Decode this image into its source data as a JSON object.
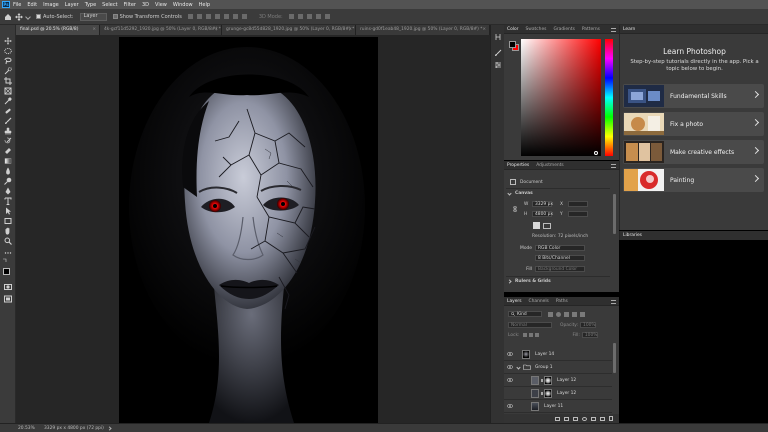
{
  "menubar": {
    "items": [
      "File",
      "Edit",
      "Image",
      "Layer",
      "Type",
      "Select",
      "Filter",
      "3D",
      "View",
      "Window",
      "Help"
    ]
  },
  "options": {
    "auto_select_label": "Auto-Select:",
    "auto_select_checked": true,
    "target_value": "Layer",
    "transform_controls_label": "Show Transform Controls",
    "transform_controls_checked": false,
    "mode_3d_label": "3D Mode:"
  },
  "tabs": [
    {
      "label": "final.psd @ 20.5% (RGB/8)",
      "active": true
    },
    {
      "label": "4k-gcf11d5292_1920.jpg @ 50% (Layer 0, RGB/8#) *",
      "active": false
    },
    {
      "label": "grunge-gc8d55d828_1920.jpg @ 50% (Layer 0, RGB/8#) *",
      "active": false
    },
    {
      "label": "ruins-gd0f1eab48_1920.jpg @ 50% (Layer 0, RGB/8#) *",
      "active": false
    }
  ],
  "color_panel": {
    "tabs": [
      "Color",
      "Swatches",
      "Gradients",
      "Patterns"
    ],
    "foreground": "#000000",
    "background": "#ff0000",
    "hue_color": "#ff0000"
  },
  "properties_panel": {
    "tabs": [
      "Properties",
      "Adjustments"
    ],
    "document_label": "Document",
    "canvas_section": "Canvas",
    "width_label": "W",
    "width_value": "3329 px",
    "height_label": "H",
    "height_value": "4800 px",
    "x_label": "X",
    "y_label": "Y",
    "resolution": "Resolution: 72 pixels/inch",
    "mode_label": "Mode",
    "mode_value": "RGB Color",
    "depth_value": "8 Bits/Channel",
    "fill_label": "Fill",
    "fill_value": "Background Color",
    "rulers_section": "Rulers & Grids"
  },
  "layers_panel": {
    "tabs": [
      "Layers",
      "Channels",
      "Paths"
    ],
    "filter_label": "Kind",
    "blend_mode": "Normal",
    "opacity_label": "Opacity:",
    "opacity_value": "100%",
    "lock_label": "Lock:",
    "fill_label": "Fill:",
    "fill_value": "100%",
    "layers": [
      {
        "name": "Layer 14",
        "visible": true,
        "type": "pixel"
      },
      {
        "name": "Group 1",
        "visible": true,
        "type": "group"
      },
      {
        "name": "Layer 12",
        "visible": true,
        "type": "masked"
      },
      {
        "name": "Layer 12",
        "visible": false,
        "type": "masked"
      },
      {
        "name": "Layer 11",
        "visible": true,
        "type": "pixel"
      }
    ]
  },
  "learn_panel": {
    "tab": "Learn",
    "title": "Learn Photoshop",
    "subtitle": "Step-by-step tutorials directly in the app. Pick a topic below to begin.",
    "cards": [
      {
        "label": "Fundamental Skills"
      },
      {
        "label": "Fix a photo"
      },
      {
        "label": "Make creative effects"
      },
      {
        "label": "Painting"
      }
    ]
  },
  "libraries_panel": {
    "tab": "Libraries"
  },
  "status": {
    "zoom": "20.53%",
    "doc_info": "3329 px x 4800 px (72 ppi)"
  }
}
